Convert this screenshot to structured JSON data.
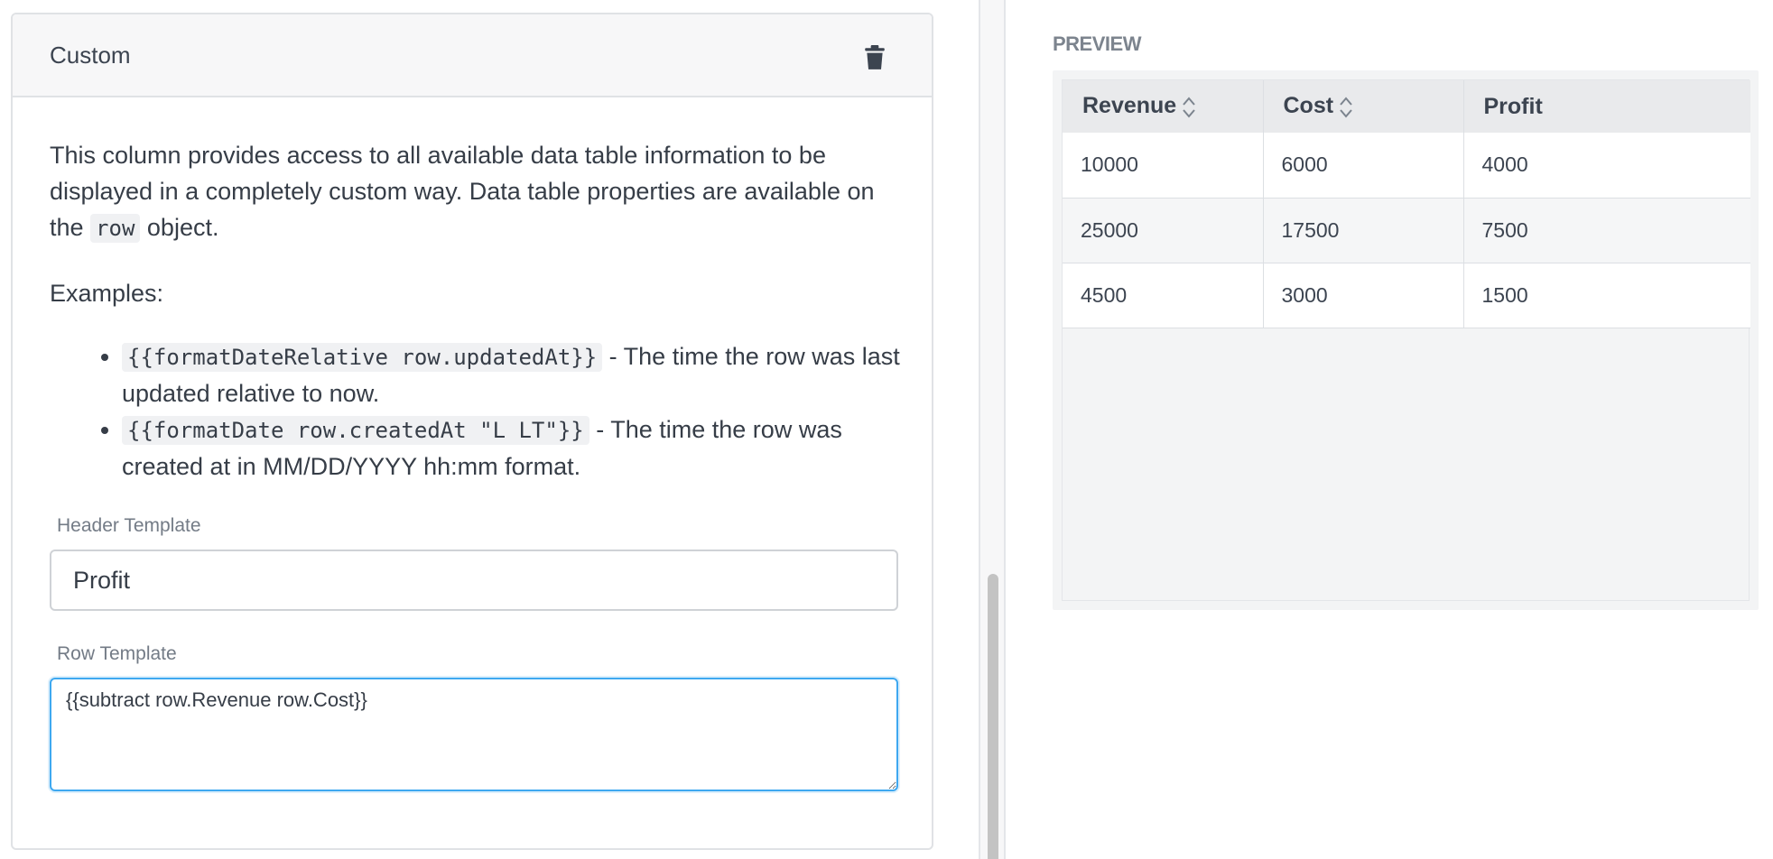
{
  "card": {
    "title": "Custom",
    "delete_icon": "trash-icon",
    "description_part1": "This column provides access to all available data table information to be displayed in a completely custom way. Data table properties are available on the ",
    "description_code": "row",
    "description_part2": " object.",
    "examples_label": "Examples:",
    "examples": [
      {
        "code": "{{formatDateRelative row.updatedAt}}",
        "text": " - The time the row was last updated relative to now."
      },
      {
        "code": "{{formatDate row.createdAt \"L LT\"}}",
        "text": " - The time the row was created at in MM/DD/YYYY hh:mm format."
      }
    ],
    "header_template_label": "Header Template",
    "header_template_value": "Profit",
    "row_template_label": "Row Template",
    "row_template_value": "{{subtract row.Revenue row.Cost}}"
  },
  "preview": {
    "label": "PREVIEW",
    "columns": [
      {
        "label": "Revenue",
        "sortable": true
      },
      {
        "label": "Cost",
        "sortable": true
      },
      {
        "label": "Profit",
        "sortable": false
      }
    ],
    "rows": [
      [
        "10000",
        "6000",
        "4000"
      ],
      [
        "25000",
        "17500",
        "7500"
      ],
      [
        "4500",
        "3000",
        "1500"
      ]
    ]
  },
  "colors": {
    "focus_border": "#3ea8f0",
    "header_bg": "#e9eaec",
    "scroll_thumb": "#c3c3c3"
  }
}
